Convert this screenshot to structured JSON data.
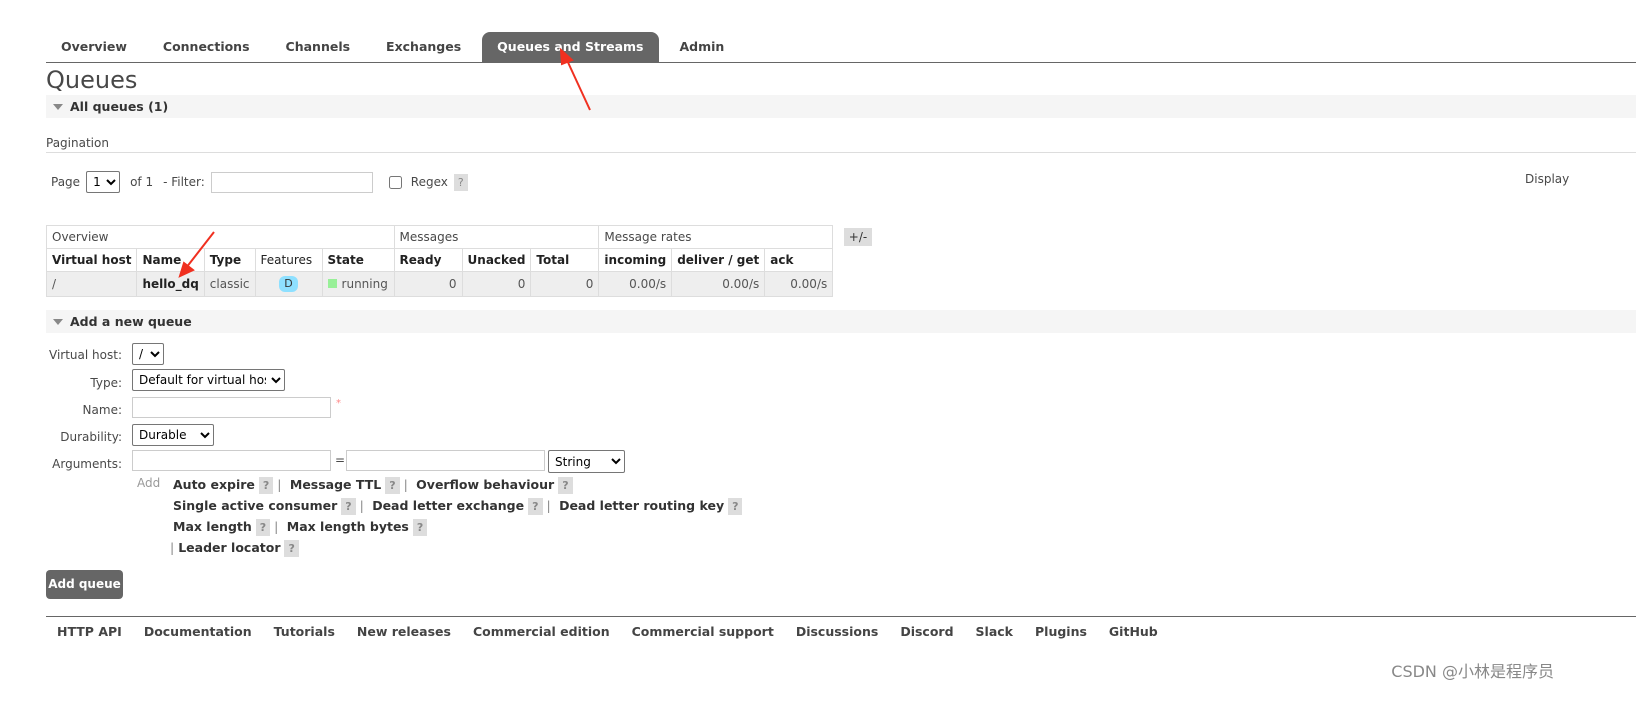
{
  "nav": {
    "tabs": [
      {
        "label": "Overview"
      },
      {
        "label": "Connections"
      },
      {
        "label": "Channels"
      },
      {
        "label": "Exchanges"
      },
      {
        "label": "Queues and Streams",
        "active": true
      },
      {
        "label": "Admin"
      }
    ]
  },
  "page_title": "Queues",
  "all_queues": {
    "title": "All queues (1)"
  },
  "pagination": {
    "label": "Pagination",
    "page_label": "Page",
    "page_value": "1",
    "of_label": "of 1",
    "filter_label": "- Filter:",
    "filter_value": "",
    "regex_label": "Regex",
    "help": "?",
    "display_label": "Display"
  },
  "table": {
    "groups": [
      "Overview",
      "Messages",
      "Message rates"
    ],
    "columns": [
      "Virtual host",
      "Name",
      "Type",
      "Features",
      "State",
      "Ready",
      "Unacked",
      "Total",
      "incoming",
      "deliver / get",
      "ack"
    ],
    "toggle": "+/-",
    "rows": [
      {
        "vhost": "/",
        "name": "hello_dq",
        "type": "classic",
        "features": "D",
        "state": "running",
        "ready": "0",
        "unacked": "0",
        "total": "0",
        "incoming": "0.00/s",
        "deliver_get": "0.00/s",
        "ack": "0.00/s"
      }
    ]
  },
  "add_queue": {
    "title": "Add a new queue",
    "vhost_label": "Virtual host:",
    "vhost_value": "/",
    "type_label": "Type:",
    "type_value": "Default for virtual host",
    "name_label": "Name:",
    "name_value": "",
    "required": "*",
    "durability_label": "Durability:",
    "durability_value": "Durable",
    "arguments_label": "Arguments:",
    "equals": "=",
    "arg_type_value": "String",
    "add_label": "Add",
    "arg_links": [
      "Auto expire",
      "Message TTL",
      "Overflow behaviour",
      "Single active consumer",
      "Dead letter exchange",
      "Dead letter routing key",
      "Max length",
      "Max length bytes",
      "Leader locator"
    ],
    "submit": "Add queue"
  },
  "footer": {
    "links": [
      "HTTP API",
      "Documentation",
      "Tutorials",
      "New releases",
      "Commercial edition",
      "Commercial support",
      "Discussions",
      "Discord",
      "Slack",
      "Plugins",
      "GitHub"
    ]
  },
  "watermark": "CSDN @小林是程序员",
  "colors": {
    "active_tab": "#666666",
    "badge": "#8ee0ff",
    "running": "#98f098",
    "annotation_arrow": "#f03020"
  }
}
